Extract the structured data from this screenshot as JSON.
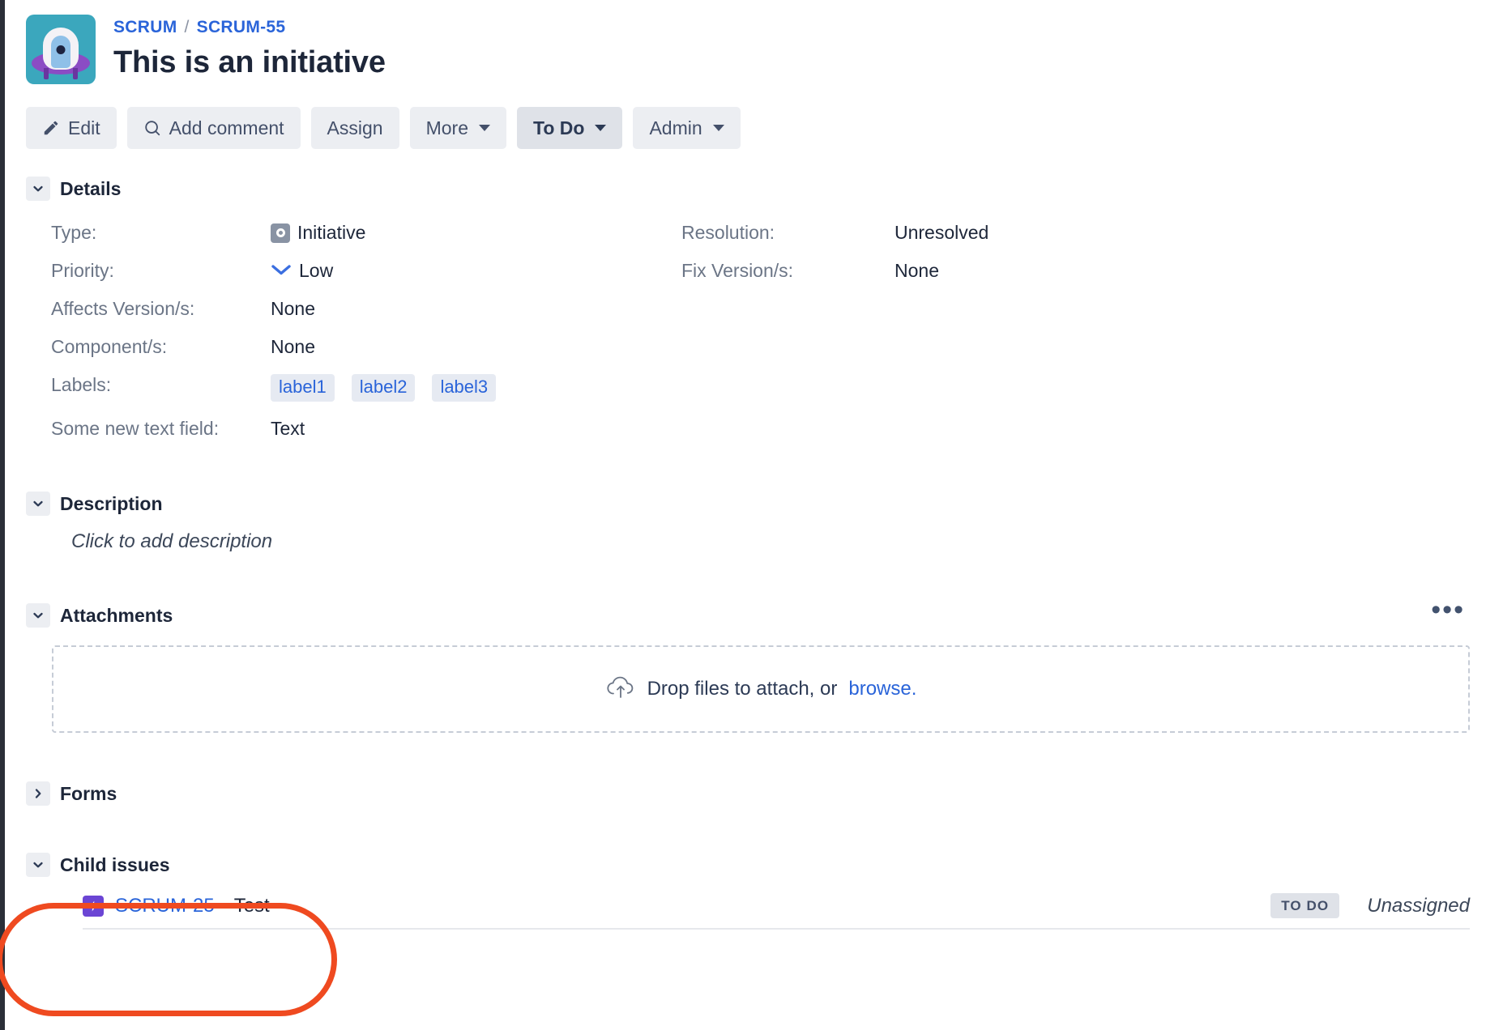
{
  "header": {
    "avatar_name": "project-avatar-ufo",
    "avatar_bg": "#3ba7bd",
    "breadcrumb": {
      "project": "SCRUM",
      "separator": "/",
      "issue_key": "SCRUM-55"
    },
    "title": "This is an initiative"
  },
  "toolbar": {
    "edit_label": "Edit",
    "add_comment_label": "Add comment",
    "assign_label": "Assign",
    "more_label": "More",
    "status_label": "To Do",
    "admin_label": "Admin"
  },
  "details": {
    "section_title": "Details",
    "fields": [
      {
        "label": "Type:",
        "value": "Initiative",
        "icon": "initiative-icon"
      },
      {
        "label": "Resolution:",
        "value": "Unresolved",
        "icon": null
      },
      {
        "label": "Priority:",
        "value": "Low",
        "icon": "priority-low-icon"
      },
      {
        "label": "Fix Version/s:",
        "value": "None",
        "icon": null
      },
      {
        "label": "Affects Version/s:",
        "value": "None",
        "icon": null
      },
      {
        "label": "Component/s:",
        "value": "None",
        "icon": null
      },
      {
        "label": "Labels:",
        "value": "",
        "icon": null
      },
      {
        "label": "Some new text field:",
        "value": "Text",
        "icon": null
      }
    ],
    "labels": [
      "label1",
      "label2",
      "label3"
    ]
  },
  "description": {
    "section_title": "Description",
    "placeholder": "Click to add description"
  },
  "attachments": {
    "section_title": "Attachments",
    "more_actions": "•••",
    "dropzone_text": "Drop files to attach, or",
    "browse_label": "browse."
  },
  "forms": {
    "section_title": "Forms"
  },
  "child_issues": {
    "section_title": "Child issues",
    "rows": [
      {
        "key": "SCRUM-25",
        "summary": "Test",
        "status": "TO DO",
        "assignee": "Unassigned",
        "icon": "epic-icon"
      }
    ]
  },
  "annotation": {
    "shape": "oval-highlight",
    "color": "#ef4a20"
  }
}
